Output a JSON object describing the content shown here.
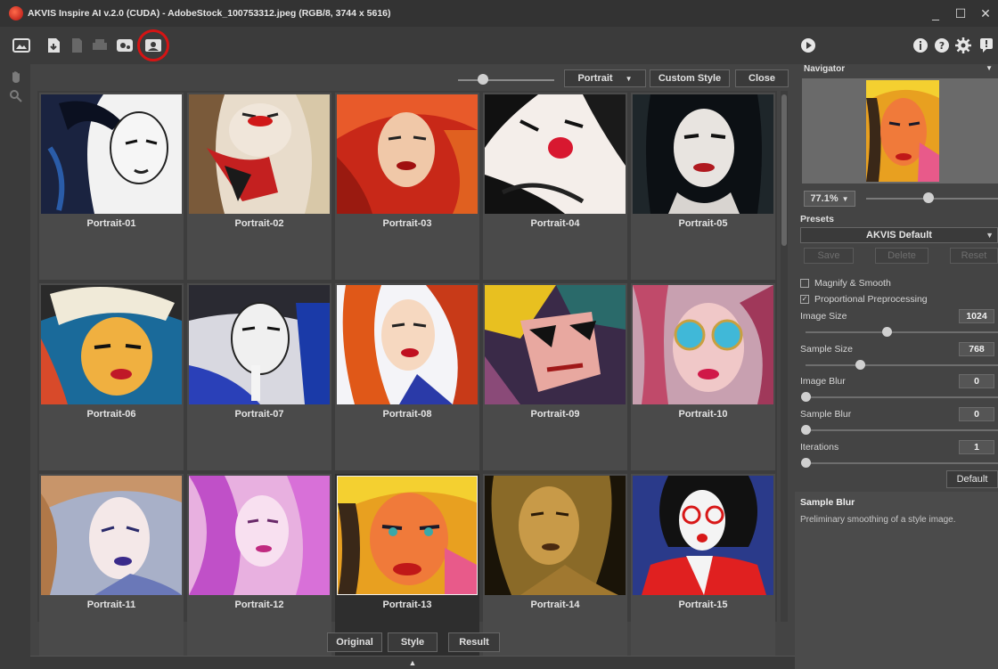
{
  "window": {
    "title": "AKVIS Inspire AI v.2.0 (CUDA) - AdobeStock_100753312.jpeg (RGB/8, 3744 x 5616)",
    "controls": [
      "_",
      "☐",
      "✕"
    ]
  },
  "toolbar": {
    "icons": [
      "open-image-icon",
      "save-image-icon",
      "batch-icon",
      "print-icon",
      "share-icon",
      "style-gallery-icon"
    ]
  },
  "gallery": {
    "category": "Portrait",
    "custom_style_label": "Custom Style",
    "close_label": "Close",
    "items": [
      {
        "label": "Portrait-01"
      },
      {
        "label": "Portrait-02"
      },
      {
        "label": "Portrait-03"
      },
      {
        "label": "Portrait-04"
      },
      {
        "label": "Portrait-05"
      },
      {
        "label": "Portrait-06"
      },
      {
        "label": "Portrait-07"
      },
      {
        "label": "Portrait-08"
      },
      {
        "label": "Portrait-09"
      },
      {
        "label": "Portrait-10"
      },
      {
        "label": "Portrait-11"
      },
      {
        "label": "Portrait-12"
      },
      {
        "label": "Portrait-13"
      },
      {
        "label": "Portrait-14"
      },
      {
        "label": "Portrait-15"
      }
    ],
    "selected": "Portrait-13"
  },
  "view_buttons": {
    "original": "Original",
    "style": "Style",
    "result": "Result"
  },
  "navigator": {
    "title": "Navigator",
    "zoom": "77.1%"
  },
  "presets": {
    "title": "Presets",
    "selected": "AKVIS Default",
    "save": "Save",
    "delete": "Delete",
    "reset": "Reset"
  },
  "settings": {
    "magnify_smooth": "Magnify & Smooth",
    "magnify_checked": false,
    "proportional": "Proportional Preprocessing",
    "proportional_checked": true,
    "image_size_label": "Image Size",
    "image_size": "1024",
    "sample_size_label": "Sample Size",
    "sample_size": "768",
    "image_blur_label": "Image Blur",
    "image_blur": "0",
    "sample_blur_label": "Sample Blur",
    "sample_blur": "0",
    "iterations_label": "Iterations",
    "iterations": "1",
    "default_label": "Default"
  },
  "hint": {
    "title": "Sample Blur",
    "text": "Preliminary smoothing of a style image."
  },
  "colors": {
    "highlight_ring": "#d61414",
    "background": "#3b3b3b",
    "panel": "#444444"
  }
}
